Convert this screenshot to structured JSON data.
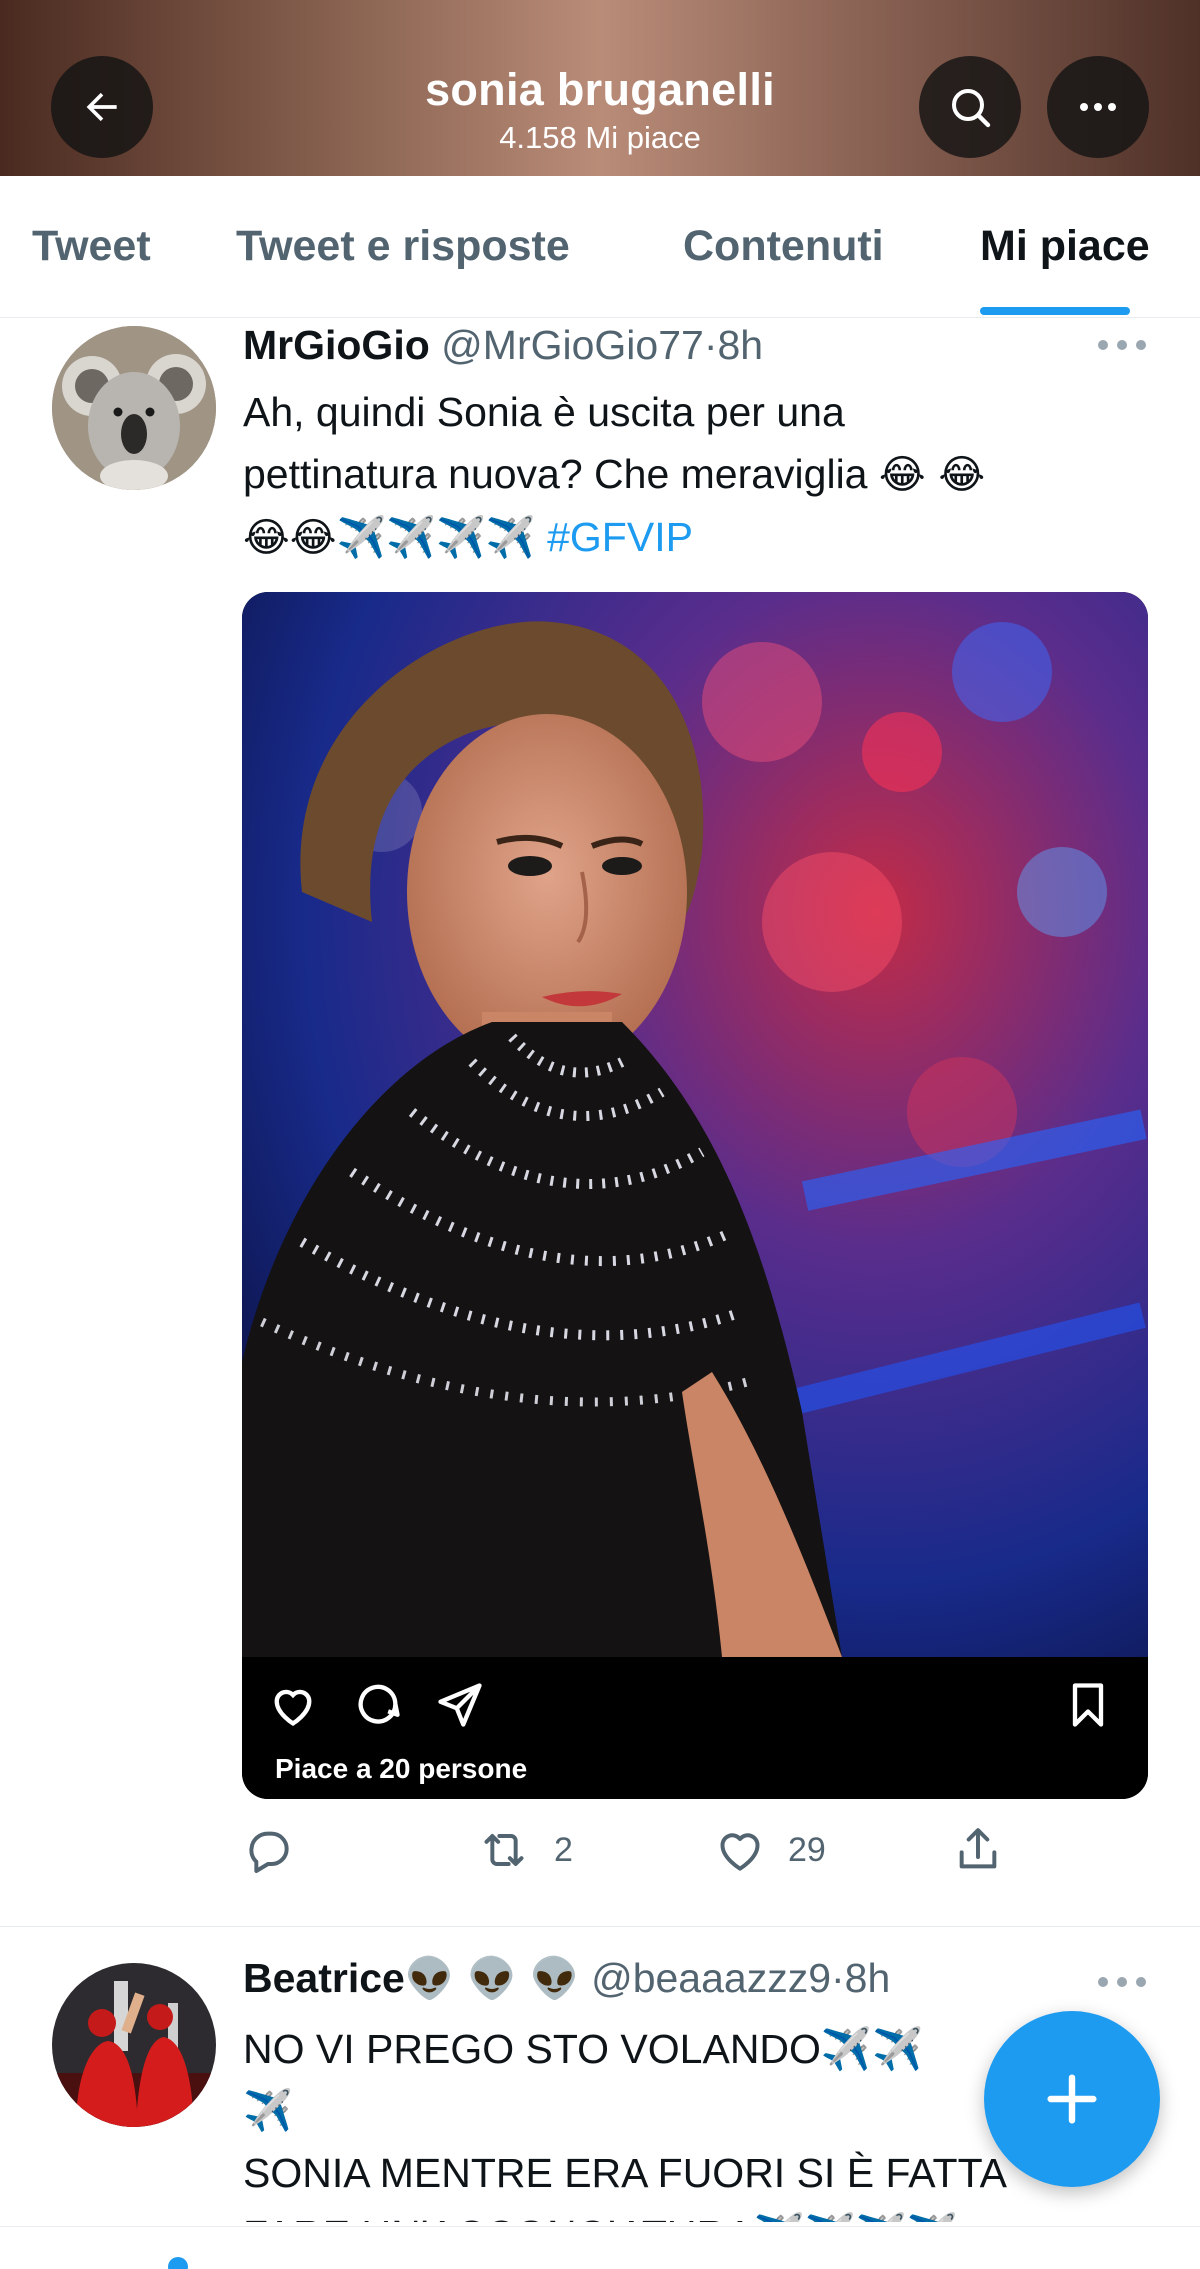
{
  "header": {
    "title": "sonia bruganelli",
    "subtitle": "4.158 Mi piace",
    "back_icon": "arrow-left-icon",
    "search_icon": "search-icon",
    "more_icon": "more-horizontal-icon"
  },
  "tabs": [
    {
      "label": "Tweet",
      "active": false
    },
    {
      "label": "Tweet e risposte",
      "active": false
    },
    {
      "label": "Contenuti",
      "active": false
    },
    {
      "label": "Mi piace",
      "active": true
    }
  ],
  "tweets": [
    {
      "name": "MrGioGio",
      "handle": "@MrGioGio77",
      "time": "8h",
      "text_lines": [
        "Ah, quindi Sonia è uscita per una",
        "pettinatura nuova? Che meraviglia"
      ],
      "emoji_line1_suffix": "😂 😂",
      "emoji_line3": "😂😂✈️✈️✈️✈️",
      "hashtag": "#GFVIP",
      "embed": {
        "likes_text": "Piace a 20 persone",
        "icons": [
          "heart-icon",
          "comment-icon",
          "send-icon",
          "bookmark-icon"
        ]
      },
      "actions": {
        "reply_count": "",
        "retweet_count": "2",
        "like_count": "29"
      }
    },
    {
      "name": "Beatrice",
      "name_emoji": "👽 👽 👽",
      "handle": "@beaaazzz9",
      "time": "8h",
      "lines": [
        "NO VI PREGO STO VOLANDO✈️✈️",
        "✈️",
        "SONIA MENTRE ERA FUORI SI È FATTA",
        "FARE UN'ACCONCIATURA✈️✈️✈️✈️"
      ]
    }
  ],
  "fab": {
    "icon": "plus-icon"
  },
  "colors": {
    "accent": "#1d9bf0",
    "text": "#0f1419",
    "muted": "#536471"
  }
}
